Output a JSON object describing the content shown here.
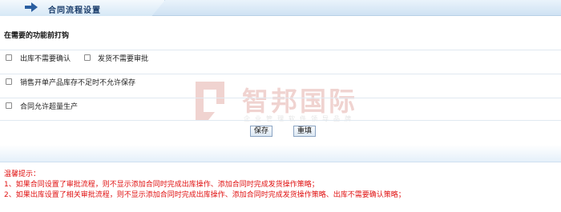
{
  "header": {
    "title": "合同流程设置",
    "icon": "arrow-right-icon"
  },
  "section": {
    "title": "在需要的功能前打钩"
  },
  "options": [
    {
      "label": "出库不需要确认",
      "checked": false
    },
    {
      "label": "发货不需要审批",
      "checked": false
    },
    {
      "label": "销售开单产品库存不足时不允许保存",
      "checked": false
    },
    {
      "label": "合同允许超量生产",
      "checked": false
    }
  ],
  "buttons": {
    "save": "保存",
    "reset": "重填"
  },
  "watermark": {
    "name": "智邦国际",
    "subtitle": "企业管理软件领导品牌"
  },
  "notice": {
    "title": "温馨提示：",
    "items": [
      "1、如果合同设置了审批流程，则不显示添加合同时完成出库操作、添加合同时完成发货操作策略；",
      "2、如果出库设置了相关审批流程，则不显示添加合同时完成出库操作、添加合同时完成发货操作策略、出库不需要确认策略；"
    ]
  },
  "colors": {
    "notice": "#e01010",
    "header_text": "#1a3d6b",
    "accent": "#2a5ea0"
  }
}
